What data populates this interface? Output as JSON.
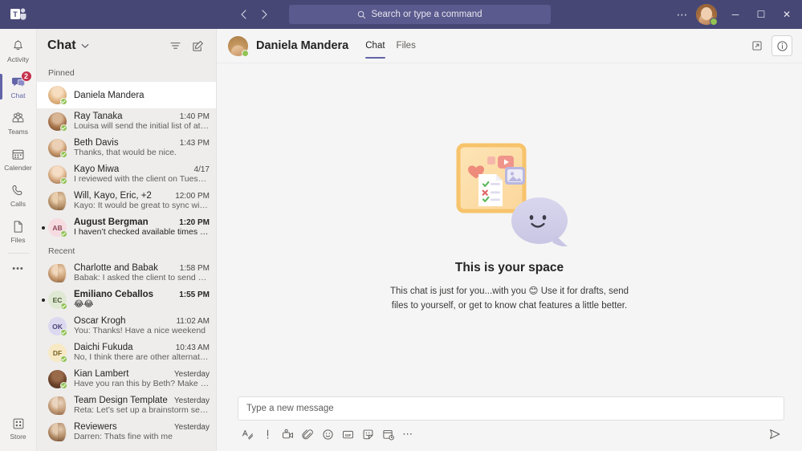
{
  "titlebar": {
    "logo_icon": "teams-logo-icon",
    "back_icon": "chevron-left-icon",
    "forward_icon": "chevron-right-icon",
    "search_placeholder": "Search or type a command",
    "search_icon": "search-icon",
    "more_label": "⋯",
    "minimize_label": "─",
    "maximize_label": "☐",
    "close_label": "✕",
    "bar_color": "#464775",
    "search_bg": "#5b5a8e"
  },
  "rail": {
    "items": [
      {
        "label": "Activity",
        "icon": "bell-icon",
        "badge": "",
        "active": false
      },
      {
        "label": "Chat",
        "icon": "chat-icon",
        "badge": "2",
        "active": true
      },
      {
        "label": "Teams",
        "icon": "teams-people-icon",
        "badge": "",
        "active": false
      },
      {
        "label": "Calender",
        "icon": "calendar-icon",
        "badge": "",
        "active": false
      },
      {
        "label": "Calls",
        "icon": "phone-icon",
        "badge": "",
        "active": false
      },
      {
        "label": "Files",
        "icon": "file-icon",
        "badge": "",
        "active": false
      }
    ],
    "more_label": "•••",
    "store": {
      "label": "Store",
      "icon": "store-icon"
    },
    "accent_color": "#6264a7",
    "badge_color": "#c4314b"
  },
  "chat_list": {
    "title": "Chat",
    "caret_icon": "chevron-down-icon",
    "filter_icon": "filter-icon",
    "compose_icon": "new-chat-icon",
    "groups": [
      {
        "label": "Pinned",
        "rows": [
          {
            "name": "Daniela Mandera",
            "time": "",
            "preview": "",
            "avatar_type": "photo",
            "photo_tone": "blonde",
            "presence": "available",
            "unread": false,
            "selected": true
          },
          {
            "name": "Ray Tanaka",
            "time": "1:40 PM",
            "preview": "Louisa will send the initial list of atte…",
            "avatar_type": "photo",
            "photo_tone": "dark",
            "presence": "available",
            "unread": false,
            "selected": false
          },
          {
            "name": "Beth Davis",
            "time": "1:43 PM",
            "preview": "Thanks, that would be nice.",
            "avatar_type": "photo",
            "photo_tone": "brunette",
            "presence": "available",
            "unread": false,
            "selected": false
          },
          {
            "name": "Kayo Miwa",
            "time": "4/17",
            "preview": "I reviewed with the client on Tuesda…",
            "avatar_type": "photo",
            "photo_tone": "asian",
            "presence": "available",
            "unread": false,
            "selected": false
          },
          {
            "name": "Will, Kayo, Eric, +2",
            "time": "12:00 PM",
            "preview": "Kayo: It would be great to sync with…",
            "avatar_type": "photo-group",
            "photo_tone": "group",
            "presence": "",
            "unread": false,
            "selected": false
          },
          {
            "name": "August Bergman",
            "time": "1:20 PM",
            "preview": "I haven’t checked available times yet",
            "avatar_type": "initials",
            "initials": "AB",
            "avatar_bg": "#f6dce1",
            "avatar_fg": "#8e4a5a",
            "presence": "available",
            "unread": true,
            "selected": false
          }
        ]
      },
      {
        "label": "Recent",
        "rows": [
          {
            "name": "Charlotte and Babak",
            "time": "1:58 PM",
            "preview": "Babak: I asked the client to send her feed…",
            "avatar_type": "photo-group",
            "photo_tone": "couple",
            "presence": "",
            "unread": false,
            "selected": false
          },
          {
            "name": "Emiliano Ceballos",
            "time": "1:55 PM",
            "preview": "😂😂",
            "avatar_type": "initials",
            "initials": "EC",
            "avatar_bg": "#dfe8d3",
            "avatar_fg": "#4a5b35",
            "presence": "available",
            "unread": true,
            "selected": false
          },
          {
            "name": "Oscar Krogh",
            "time": "11:02 AM",
            "preview": "You: Thanks! Have a nice weekend",
            "avatar_type": "initials",
            "initials": "OK",
            "avatar_bg": "#dcd8ef",
            "avatar_fg": "#4a4577",
            "presence": "available",
            "unread": false,
            "selected": false
          },
          {
            "name": "Daichi Fukuda",
            "time": "10:43 AM",
            "preview": "No, I think there are other alternatives we c…",
            "avatar_type": "initials",
            "initials": "DF",
            "avatar_bg": "#f7e9c4",
            "avatar_fg": "#7a6327",
            "presence": "available",
            "unread": false,
            "selected": false
          },
          {
            "name": "Kian Lambert",
            "time": "Yesterday",
            "preview": "Have you ran this by Beth? Make sure she is…",
            "avatar_type": "photo",
            "photo_tone": "darkskin",
            "presence": "available",
            "unread": false,
            "selected": false
          },
          {
            "name": "Team Design Template",
            "time": "Yesterday",
            "preview": "Reta: Let’s set up a brainstorm session for…",
            "avatar_type": "photo-group",
            "photo_tone": "team",
            "presence": "",
            "unread": false,
            "selected": false
          },
          {
            "name": "Reviewers",
            "time": "Yesterday",
            "preview": "Darren: Thats fine with me",
            "avatar_type": "photo-group",
            "photo_tone": "reviewers",
            "presence": "",
            "unread": false,
            "selected": false
          }
        ]
      }
    ]
  },
  "chat_header": {
    "name": "Daniela Mandera",
    "presence": "available",
    "tabs": [
      {
        "label": "Chat",
        "active": true
      },
      {
        "label": "Files",
        "active": false
      }
    ],
    "popout_icon": "pop-out-icon",
    "info_icon": "info-icon"
  },
  "empty_state": {
    "illustration_icon": "your-space-illustration",
    "title": "This is your space",
    "description": "This chat is just for you...with you 😊 Use it for drafts, send files to yourself, or get to know chat features a little better."
  },
  "compose": {
    "placeholder": "Type a new message",
    "tools": [
      {
        "icon": "format-text-icon",
        "label": "Format"
      },
      {
        "icon": "important-icon",
        "label": "Set delivery options"
      },
      {
        "icon": "meet-now-icon",
        "label": "Meet now"
      },
      {
        "icon": "attach-icon",
        "label": "Attach"
      },
      {
        "icon": "emoji-icon",
        "label": "Emoji"
      },
      {
        "icon": "giphy-icon",
        "label": "Giphy"
      },
      {
        "icon": "sticker-icon",
        "label": "Sticker"
      },
      {
        "icon": "schedule-message-icon",
        "label": "Schedule"
      },
      {
        "icon": "more-options-icon",
        "label": "More options"
      }
    ],
    "send_icon": "send-icon"
  }
}
